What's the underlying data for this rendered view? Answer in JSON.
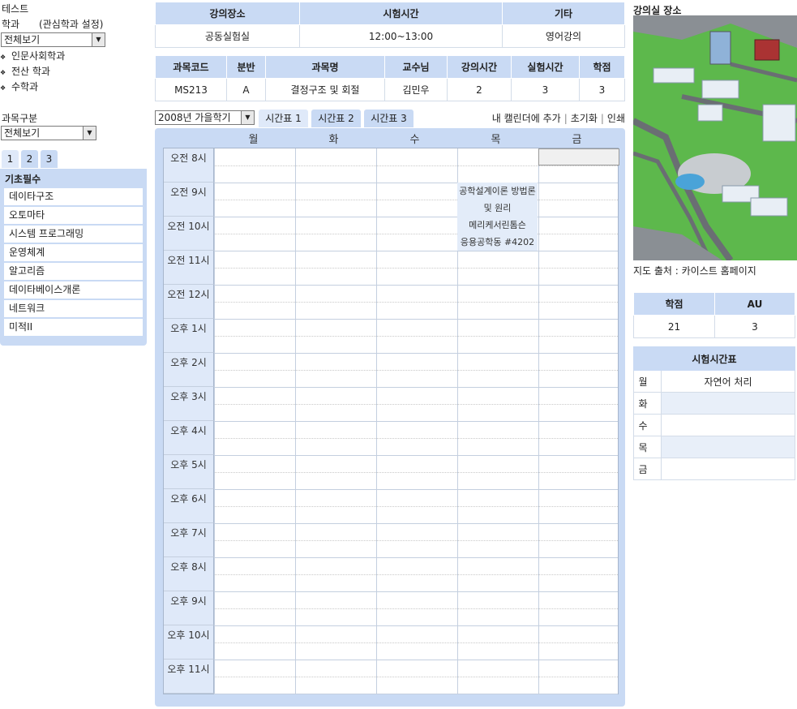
{
  "left": {
    "test_label": "테스트",
    "dept_label": "학과",
    "interest_label": "(관심학과 설정)",
    "dept_select": "전체보기",
    "departments": [
      "인문사회학과",
      "전산 학과",
      "수학과"
    ],
    "category_label": "과목구분",
    "category_select": "전체보기",
    "page_tabs": [
      "1",
      "2",
      "3"
    ],
    "panel_title": "기초필수",
    "courses": [
      "데이타구조",
      "오토마타",
      "시스템 프로그래밍",
      "운영체계",
      "알고리즘",
      "데이타베이스개론",
      "네트워크",
      "미적II"
    ]
  },
  "exam_info": {
    "headers": [
      "강의장소",
      "시험시간",
      "기타"
    ],
    "row": [
      "공동실험실",
      "12:00~13:00",
      "영어강의"
    ]
  },
  "course_info": {
    "headers": [
      "과목코드",
      "분반",
      "과목명",
      "교수님",
      "강의시간",
      "실험시간",
      "학점"
    ],
    "row": [
      "MS213",
      "A",
      "결정구조 및 회절",
      "김민우",
      "2",
      "3",
      "3"
    ]
  },
  "schedule": {
    "semester_select": "2008년 가을학기",
    "tabs": [
      "시간표 1",
      "시간표 2",
      "시간표 3"
    ],
    "actions": [
      "내 캘린더에 추가",
      "초기화",
      "인쇄"
    ],
    "days": [
      "월",
      "화",
      "수",
      "목",
      "금"
    ],
    "times": [
      "오전 8시",
      "오전 9시",
      "오전 10시",
      "오전 11시",
      "오전 12시",
      "오후 1시",
      "오후 2시",
      "오후 3시",
      "오후 4시",
      "오후 5시",
      "오후 6시",
      "오후 7시",
      "오후 8시",
      "오후 9시",
      "오후 10시",
      "오후 11시"
    ],
    "slot_lines": [
      "공학설계이론 방법론",
      "및 원리",
      "메리케서린톰슨",
      "응용공학동 #4202"
    ]
  },
  "right": {
    "map_title": "강의실 장소",
    "map_source": "지도 출처 : 카이스트 홈페이지",
    "credit_headers": [
      "학점",
      "AU"
    ],
    "credit_values": [
      "21",
      "3"
    ],
    "exam_title": "시험시간표",
    "exam_days": [
      "월",
      "화",
      "수",
      "목",
      "금"
    ],
    "exam_values": [
      "자연어 처리",
      "",
      "",
      "",
      ""
    ]
  },
  "colors": {
    "panel": "#c9daf4",
    "light": "#dfe9f9",
    "map_green": "#5db84c"
  }
}
